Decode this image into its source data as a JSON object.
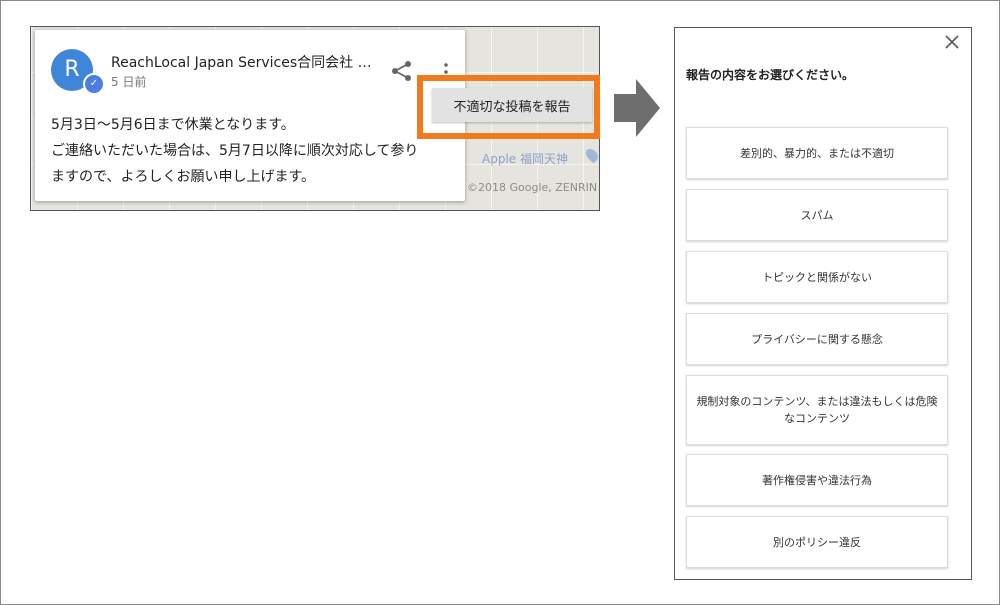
{
  "post_card": {
    "avatar_letter": "R",
    "business_name": "ReachLocal Japan Services合同会社 …",
    "time_ago": "5 日前",
    "body_lines": [
      "5月3日〜5月6日まで休業となります。",
      "ご連絡いただいた場合は、5月7日以降に順次対応して参り",
      "ますので、よろしくお願い申し上げます。"
    ],
    "report_menu_label": "不適切な投稿を報告"
  },
  "map": {
    "place_label": "Apple 福岡天神",
    "copyright": "©2018 Google, ZENRIN"
  },
  "icons": {
    "verified": "verified-check-icon",
    "share": "share-icon",
    "more": "more-vert-icon",
    "arrow": "right-arrow-icon",
    "close": "close-icon"
  },
  "colors": {
    "highlight": "#f07a1e",
    "avatar": "#3f86d8",
    "arrow": "#6e6e6e"
  },
  "report_dialog": {
    "title": "報告の内容をお選びください。",
    "options": [
      "差別的、暴力的、または不適切",
      "スパム",
      "トピックと関係がない",
      "プライバシーに関する懸念",
      "規制対象のコンテンツ、または違法もしくは危険なコンテンツ",
      "著作権侵害や違法行為",
      "別のポリシー違反"
    ]
  }
}
